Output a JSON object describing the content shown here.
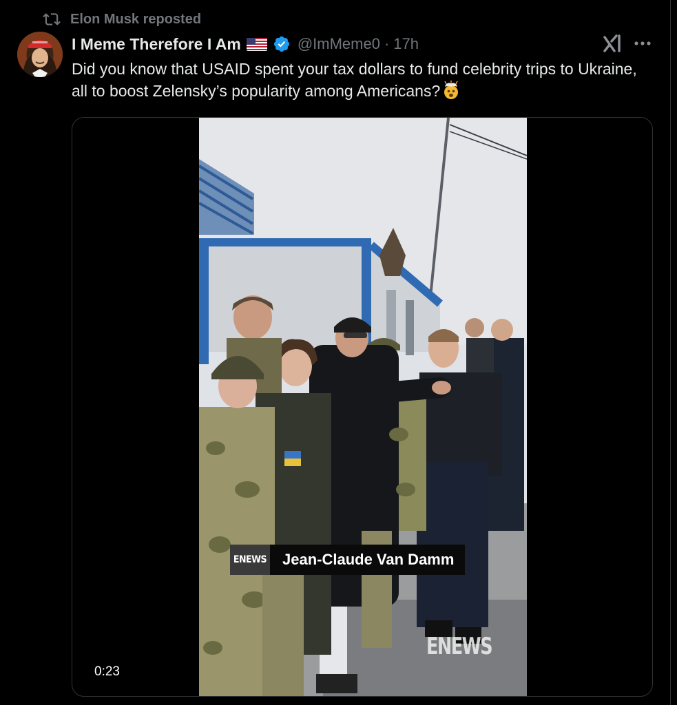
{
  "repost": {
    "label": "Elon Musk reposted",
    "icon": "repost-icon"
  },
  "post": {
    "display_name": "I Meme Therefore I Am",
    "flag_icon": "us-flag-icon",
    "verified_icon": "verified-badge-icon",
    "handle": "@ImMeme0",
    "separator": "·",
    "time": "17h",
    "text": "Did you know that USAID spent your tax dollars to fund celebrity trips to Ukraine, all to boost Zelensky’s popularity among Americans?",
    "text_emoji": "exploding-head-emoji"
  },
  "actions": {
    "grok_icon": "grok-icon",
    "more_icon": "more-options-icon"
  },
  "video": {
    "duration": "0:23",
    "lower_third_logo": "ENEWS",
    "lower_third_name": "Jean-Claude Van Damm",
    "watermark": "ENEWS"
  },
  "colors": {
    "background": "#000000",
    "text": "#e7e9ea",
    "muted": "#71767b",
    "verified": "#1d9bf0",
    "border": "#2f3336"
  }
}
